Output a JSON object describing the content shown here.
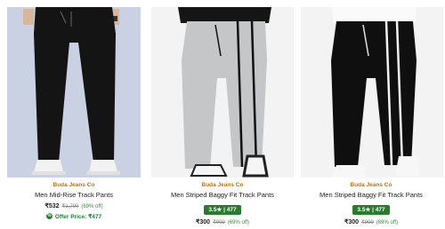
{
  "products": [
    {
      "brand": "Buda Jeans Co",
      "title": "Men Mid-Rise Track Pants",
      "price": "₹532",
      "mrp": "₹1,799",
      "discount": "(69% off)",
      "offer_text": "Offer Price: ₹477",
      "image_icon": "pants-photo"
    },
    {
      "brand": "Buda Jeans Co",
      "title": "Men Striped Baggy Fit Track Pants",
      "rating": "3.5★ | 477",
      "price": "₹300",
      "mrp": "₹999",
      "discount": "(69% off)",
      "image_icon": "pants-photo"
    },
    {
      "brand": "Buda Jeans Co",
      "title": "Men Striped Baggy Fit Track Pants",
      "rating": "3.5★ | 477",
      "price": "₹300",
      "mrp": "₹999",
      "discount": "(69% off)",
      "image_icon": "pants-photo"
    }
  ],
  "colors": {
    "brand": "#b3770c",
    "rating_bg": "#2a7a2e",
    "discount": "#388e3c"
  }
}
